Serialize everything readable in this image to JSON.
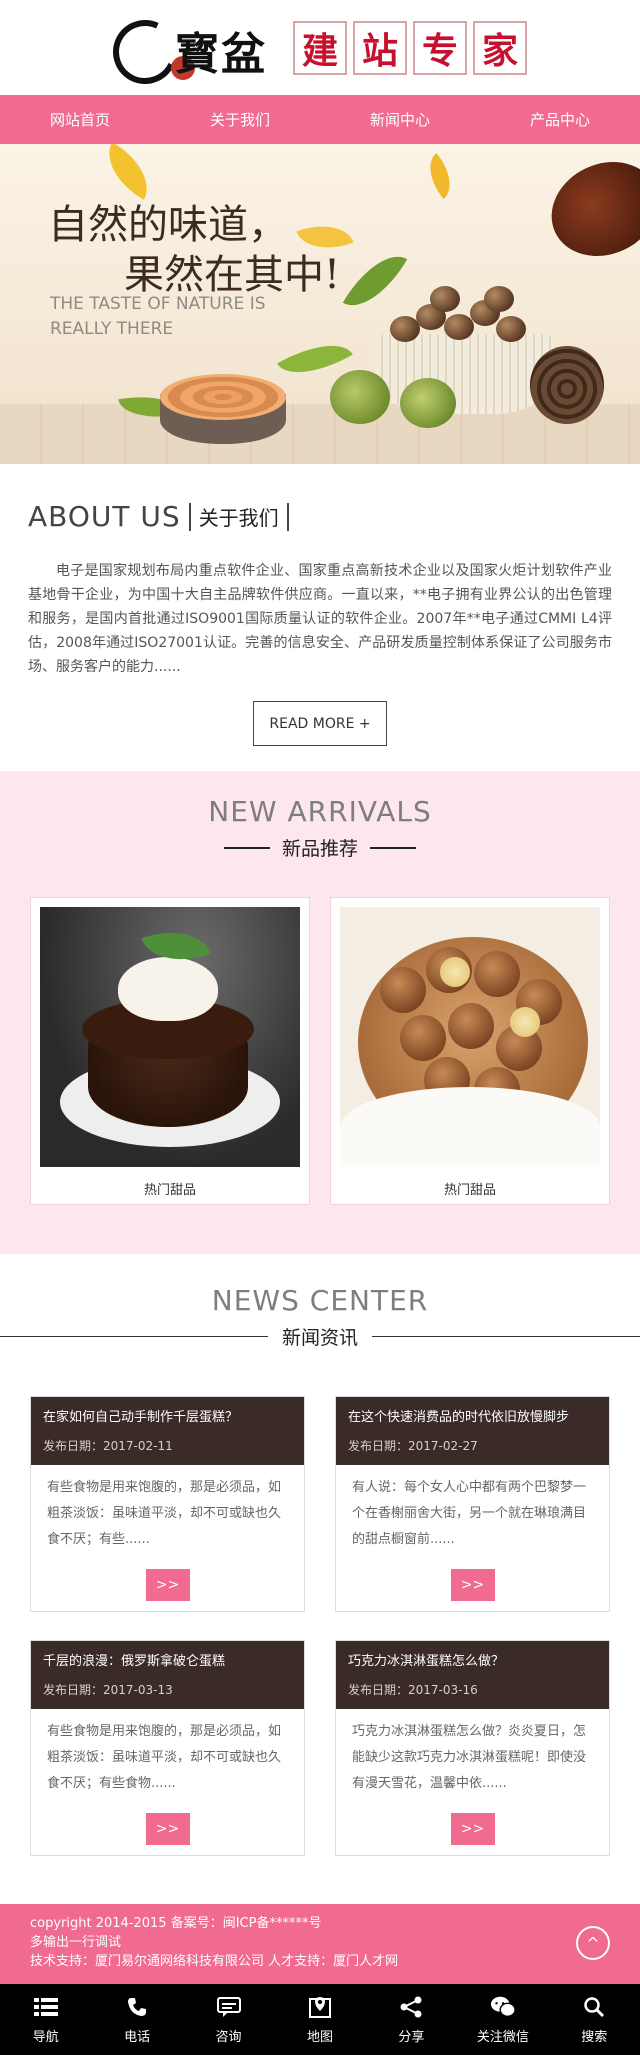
{
  "header": {
    "logo_text": "寳盆",
    "logo_boxes": [
      "建",
      "站",
      "专",
      "家"
    ]
  },
  "nav": [
    "网站首页",
    "关于我们",
    "新闻中心",
    "产品中心"
  ],
  "banner": {
    "line1": "自然的味道，",
    "line2": "果然在其中!",
    "en1": "THE TASTE OF NATURE IS",
    "en2": "REALLY THERE"
  },
  "about": {
    "title_en": "ABOUT US",
    "title_cn": "关于我们",
    "text": "电子是国家规划布局内重点软件企业、国家重点高新技术企业以及国家火炬计划软件产业基地骨干企业，为中国十大自主品牌软件供应商。一直以来，**电子拥有业界公认的出色管理和服务，是国内首批通过ISO9001国际质量认证的软件企业。2007年**电子通过CMMI L4评估，2008年通过ISO27001认证。完善的信息安全、产品研发质量控制体系保证了公司服务市场、服务客户的能力......",
    "read_more": "READ MORE +"
  },
  "arrivals": {
    "title_en": "NEW ARRIVALS",
    "title_cn": "新品推荐",
    "items": [
      {
        "name": "热门甜品"
      },
      {
        "name": "热门甜品"
      }
    ]
  },
  "news": {
    "title_en": "NEWS CENTER",
    "title_cn": "新闻资讯",
    "more": ">>",
    "items": [
      {
        "title": "在家如何自己动手制作千层蛋糕？",
        "date": "发布日期：2017-02-11",
        "summary": "有些食物是用来饱腹的，那是必须品，如粗茶淡饭：虽味道平淡，却不可或缺也久食不厌；有些......"
      },
      {
        "title": "在这个快速消费品的时代依旧放慢脚步",
        "date": "发布日期：2017-02-27",
        "summary": "有人说：每个女人心中都有两个巴黎梦一个在香榭丽舍大街，另一个就在琳琅满目的甜点橱窗前......"
      },
      {
        "title": "千层的浪漫：俄罗斯拿破仑蛋糕",
        "date": "发布日期：2017-03-13",
        "summary": "有些食物是用来饱腹的，那是必须品，如粗茶淡饭：虽味道平淡，却不可或缺也久食不厌；有些食物......"
      },
      {
        "title": "巧克力冰淇淋蛋糕怎么做？",
        "date": "发布日期：2017-03-16",
        "summary": "巧克力冰淇淋蛋糕怎么做？炎炎夏日，怎能缺少这款巧克力冰淇淋蛋糕呢！即使没有漫天雪花，温馨中依......"
      }
    ]
  },
  "footer": {
    "line1": "copyright 2014-2015 备案号：闽ICP备******号",
    "line2": "多输出一行调试",
    "line3": "技术支持：厦门易尔通网络科技有限公司 人才支持：厦门人才网",
    "to_top": "^"
  },
  "bottombar": [
    {
      "label": "导航",
      "icon": "menu-icon"
    },
    {
      "label": "电话",
      "icon": "phone-icon"
    },
    {
      "label": "咨询",
      "icon": "chat-icon"
    },
    {
      "label": "地图",
      "icon": "map-icon"
    },
    {
      "label": "分享",
      "icon": "share-icon"
    },
    {
      "label": "关注微信",
      "icon": "wechat-icon"
    },
    {
      "label": "搜索",
      "icon": "search-icon"
    }
  ],
  "colors": {
    "accent": "#f06b8f",
    "arrivals_bg": "#fde6ee",
    "news_header": "#3a2a28",
    "bottombar": "#000000"
  }
}
